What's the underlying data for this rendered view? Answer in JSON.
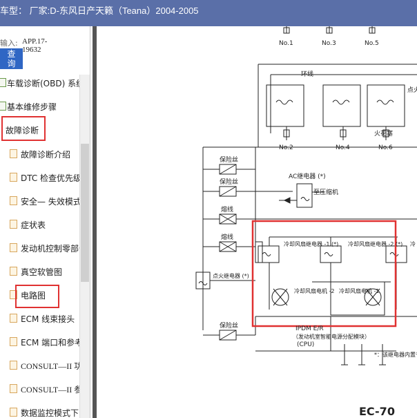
{
  "title": "车型： 厂家:D-东风日产天籁（Teana）2004-2005",
  "sidebar": {
    "search_label": "输入:",
    "app_id": "APP.17-19632",
    "query_button": "查\n询",
    "items": [
      {
        "label": "车载诊断(OBD) 系统",
        "type": "book"
      },
      {
        "label": "基本维修步骤",
        "type": "book"
      },
      {
        "label": "故障诊断",
        "type": "folder",
        "highlighted": true
      },
      {
        "label": "故障诊断介绍",
        "type": "doc"
      },
      {
        "label": "DTC 检查优先级",
        "type": "doc"
      },
      {
        "label": "安全— 失效模式",
        "type": "doc"
      },
      {
        "label": "症状表",
        "type": "doc"
      },
      {
        "label": "发动机控制零部件",
        "type": "doc"
      },
      {
        "label": "真空软管图",
        "type": "doc"
      },
      {
        "label": "电路图",
        "type": "doc",
        "highlighted": true
      },
      {
        "label": "ECM 线束接头",
        "type": "doc"
      },
      {
        "label": "ECM 端口和参考值",
        "type": "doc"
      },
      {
        "label": "CONSULT—II 功能",
        "type": "doc"
      },
      {
        "label": "CONSULT—II 参考值",
        "type": "doc"
      },
      {
        "label": "数据监控模式下",
        "type": "doc"
      }
    ]
  },
  "diagram": {
    "coil_labels_top": [
      "No.1",
      "No.3",
      "No.5"
    ],
    "coil_labels_bottom": [
      "No.2",
      "No.4",
      "No.6"
    ],
    "ring_line": "环线",
    "ignition_coil_side": "点火线圈（带功率晶体管）",
    "spark_plug": "火花塞",
    "fuse1": "保险丝",
    "fuse2": "保险丝",
    "fusible1": "熔线",
    "fusible2": "熔线",
    "fuse3": "保险丝",
    "ac_relay": "AC继电器 (*)",
    "to_compressor": "至压缩机",
    "fan_relay1": "冷却风扇继电器 -1 (*)",
    "fan_relay2": "冷却风扇继电器 -2 (*)",
    "fan_relay3": "冷",
    "ign_relay": "点火继电器 (*)",
    "fan_motor2": "冷却风扇电机 -2",
    "fan_motor1": "冷却风扇电机 -1",
    "ipdm": "IPDM E/R",
    "ipdm_desc": "（发动机室智能电源分配模块）",
    "cpu": "(CPU)",
    "note": "*：该继电器内置于（发动机室智能...）",
    "page": "EC-70"
  }
}
